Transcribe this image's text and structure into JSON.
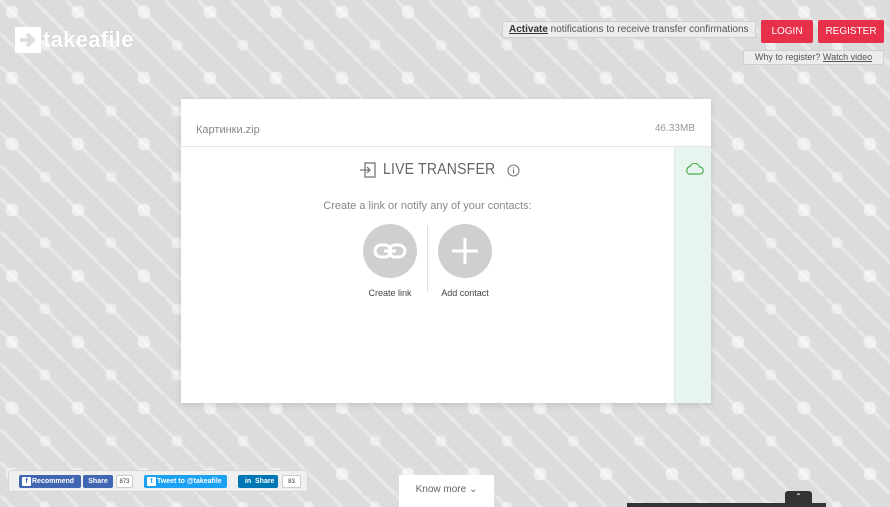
{
  "header": {
    "logo_text": "takeafile",
    "notice_link": "Activate",
    "notice_text": " notifications to receive transfer confirmations",
    "login_label": "LOGIN",
    "register_label": "REGISTER",
    "register_hint_text": "Why to register? ",
    "register_hint_link": "Watch video"
  },
  "file": {
    "name": "Картинки.zip",
    "size": "46.33MB"
  },
  "transfer": {
    "title": "LIVE TRANSFER",
    "subtitle": "Create a link or notify any of your contacts:",
    "actions": [
      {
        "label": "Create link",
        "icon": "link-icon"
      },
      {
        "label": "Add contact",
        "icon": "plus-icon"
      }
    ]
  },
  "social": {
    "fb_recommend": "Recommend",
    "fb_share": "Share",
    "fb_count": "873",
    "tweet": "Tweet to @takeafile",
    "li_share": "Share",
    "li_count": "83"
  },
  "footer": {
    "know_more": "Know more"
  },
  "colors": {
    "accent": "#e8304a",
    "panel": "#e7f5ee",
    "cloud": "#4caf50"
  }
}
